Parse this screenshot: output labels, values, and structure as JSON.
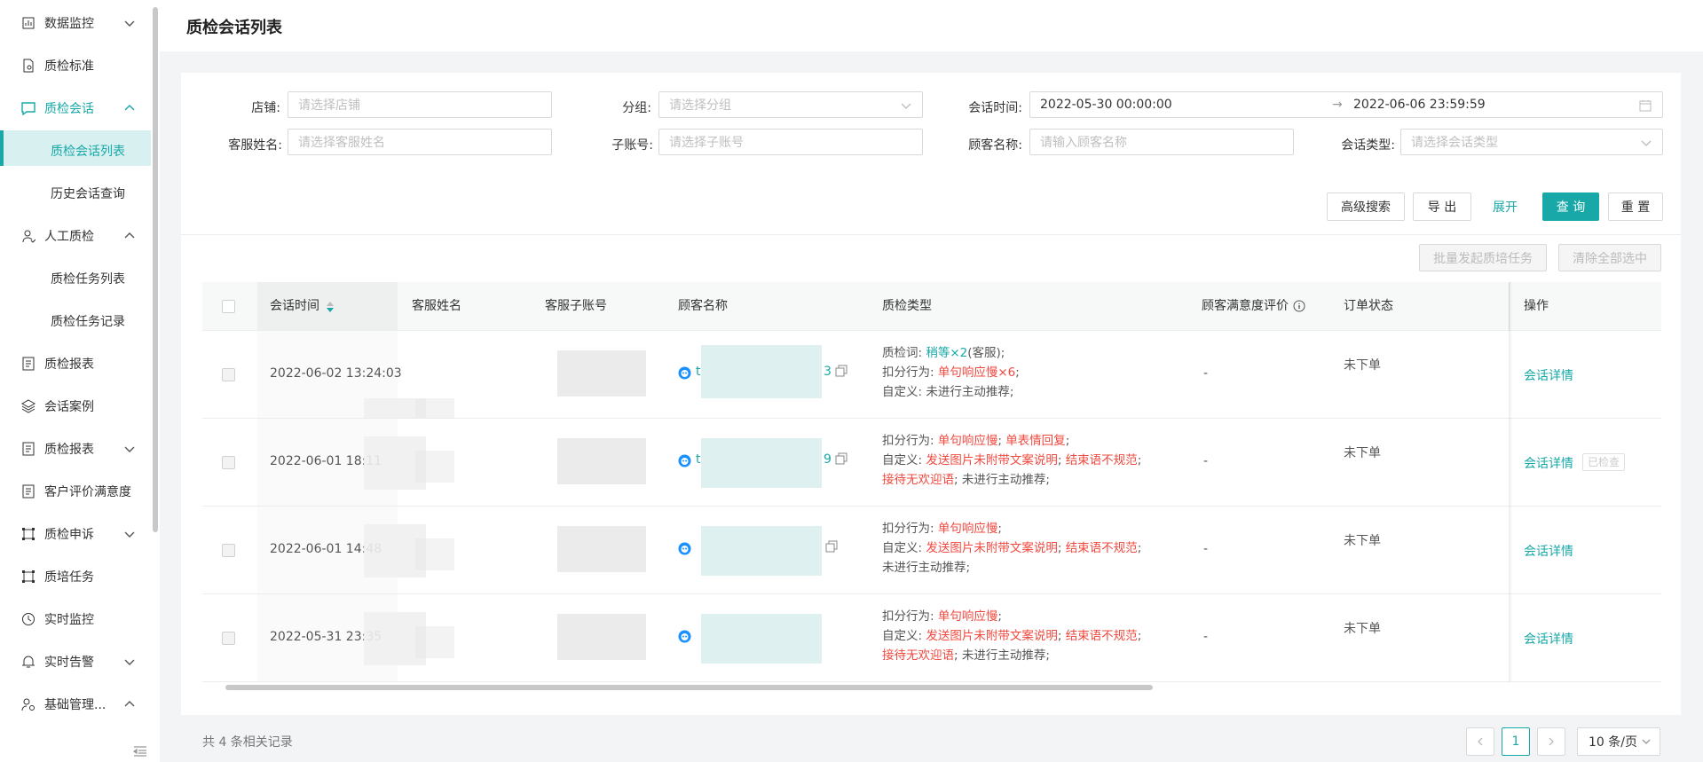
{
  "sidebar": {
    "items": [
      {
        "label": "数据监控",
        "icon": "bar-chart-icon",
        "arrow": "chevron-down"
      },
      {
        "label": "质检标准",
        "icon": "document-icon"
      },
      {
        "label": "质检会话",
        "icon": "chat-icon",
        "arrow": "chevron-up",
        "active": true
      },
      {
        "label": "质检会话列表",
        "sub": true,
        "selected": true
      },
      {
        "label": "历史会话查询",
        "sub": true
      },
      {
        "label": "人工质检",
        "icon": "user-icon",
        "arrow": "chevron-up"
      },
      {
        "label": "质检任务列表",
        "sub": true
      },
      {
        "label": "质检任务记录",
        "sub": true
      },
      {
        "label": "质检报表",
        "icon": "report-icon"
      },
      {
        "label": "会话案例",
        "icon": "layers-icon"
      },
      {
        "label": "质检报表",
        "icon": "report-icon",
        "arrow": "chevron-down"
      },
      {
        "label": "客户评价满意度",
        "icon": "report-icon"
      },
      {
        "label": "质检申诉",
        "icon": "frame-icon",
        "arrow": "chevron-down"
      },
      {
        "label": "质培任务",
        "icon": "frame-icon"
      },
      {
        "label": "实时监控",
        "icon": "clock-icon"
      },
      {
        "label": "实时告警",
        "icon": "bell-icon",
        "arrow": "chevron-down"
      },
      {
        "label": "基础管理...",
        "icon": "user-settings-icon",
        "arrow": "chevron-up"
      }
    ]
  },
  "header": {
    "title": "质检会话列表"
  },
  "filters": {
    "shop_label": "店铺:",
    "shop_placeholder": "请选择店铺",
    "group_label": "分组:",
    "group_placeholder": "请选择分组",
    "time_label": "会话时间:",
    "time_start": "2022-05-30 00:00:00",
    "time_end": "2022-06-06 23:59:59",
    "agent_label": "客服姓名:",
    "agent_placeholder": "请选择客服姓名",
    "subaccount_label": "子账号:",
    "subaccount_placeholder": "请选择子账号",
    "customer_label": "顾客名称:",
    "customer_placeholder": "请输入顾客名称",
    "type_label": "会话类型:",
    "type_placeholder": "请选择会话类型"
  },
  "actions": {
    "advanced": "高级搜索",
    "export": "导 出",
    "expand": "展开",
    "query": "查 询",
    "reset": "重 置",
    "batch": "批量发起质培任务",
    "clear": "清除全部选中"
  },
  "table": {
    "columns": [
      "会话时间",
      "客服姓名",
      "客服子账号",
      "顾客名称",
      "质检类型",
      "顾客满意度评价",
      "订单状态",
      "操作"
    ],
    "rows": [
      {
        "time": "2022-06-02 13:24:03",
        "customer_prefix": "t",
        "customer_suffix": "3",
        "lines": [
          [
            {
              "t": "质检词: "
            },
            {
              "t": "稍等×2",
              "c": "teal"
            },
            {
              "t": "(客服);"
            }
          ],
          [
            {
              "t": "扣分行为: "
            },
            {
              "t": "单句响应慢×6",
              "c": "red"
            },
            {
              "t": ";"
            }
          ],
          [
            {
              "t": "自定义: 未进行主动推荐;"
            }
          ]
        ],
        "satisfaction": "-",
        "order": "未下单",
        "op": "会话详情"
      },
      {
        "time": "2022-06-01 18:11",
        "customer_prefix": "t",
        "customer_suffix": "9",
        "lines": [
          [
            {
              "t": "扣分行为: "
            },
            {
              "t": "单句响应慢",
              "c": "red"
            },
            {
              "t": "; "
            },
            {
              "t": "单表情回复",
              "c": "red"
            },
            {
              "t": ";"
            }
          ],
          [
            {
              "t": "自定义: "
            },
            {
              "t": "发送图片未附带文案说明",
              "c": "red"
            },
            {
              "t": "; "
            },
            {
              "t": "结束语不规范",
              "c": "red"
            },
            {
              "t": ";"
            }
          ],
          [
            {
              "t": "接待无欢迎语",
              "c": "red"
            },
            {
              "t": "; 未进行主动推荐;"
            }
          ]
        ],
        "satisfaction": "-",
        "order": "未下单",
        "op": "会话详情",
        "tag": "已检查"
      },
      {
        "time": "2022-06-01 14:48",
        "customer_prefix": "",
        "customer_suffix": "",
        "lines": [
          [
            {
              "t": "扣分行为: "
            },
            {
              "t": "单句响应慢",
              "c": "red"
            },
            {
              "t": ";"
            }
          ],
          [
            {
              "t": "自定义: "
            },
            {
              "t": "发送图片未附带文案说明",
              "c": "red"
            },
            {
              "t": "; "
            },
            {
              "t": "结束语不规范",
              "c": "red"
            },
            {
              "t": ";"
            }
          ],
          [
            {
              "t": "未进行主动推荐;"
            }
          ]
        ],
        "satisfaction": "-",
        "order": "未下单",
        "op": "会话详情"
      },
      {
        "time": "2022-05-31 23:35",
        "customer_prefix": "",
        "customer_suffix": "",
        "lines": [
          [
            {
              "t": "扣分行为: "
            },
            {
              "t": "单句响应慢",
              "c": "red"
            },
            {
              "t": ";"
            }
          ],
          [
            {
              "t": "自定义: "
            },
            {
              "t": "发送图片未附带文案说明",
              "c": "red"
            },
            {
              "t": "; "
            },
            {
              "t": "结束语不规范",
              "c": "red"
            },
            {
              "t": ";"
            }
          ],
          [
            {
              "t": "接待无欢迎语",
              "c": "red"
            },
            {
              "t": "; 未进行主动推荐;"
            }
          ]
        ],
        "satisfaction": "-",
        "order": "未下单",
        "op": "会话详情"
      }
    ]
  },
  "footer": {
    "total": "共 4 条相关记录",
    "current_page": "1",
    "page_size": "10 条/页"
  },
  "colors": {
    "accent": "#18a8a8",
    "danger": "#f0493f"
  }
}
